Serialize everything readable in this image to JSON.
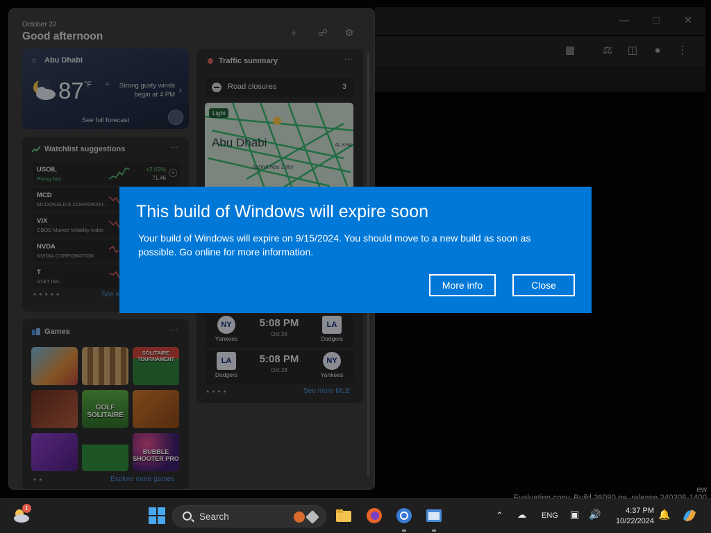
{
  "browser": {
    "toolbar_icons": [
      "extensions-icon",
      "labs-icon",
      "sidebar-icon",
      "profile-icon",
      "menu-icon"
    ],
    "evaluation_text": "Evaluation copy. Build 26080.ge_release.240308-1400",
    "edge_letters": [
      "ew"
    ]
  },
  "widgets": {
    "date": "October 22",
    "greeting": "Good afternoon",
    "weather": {
      "location": "Abu Dhabi",
      "temperature": "87",
      "unit": "°F",
      "alert": "Strong gusty winds begin at 4 PM",
      "forecast_link": "See full forecast"
    },
    "watchlist": {
      "title": "Watchlist suggestions",
      "stocks": [
        {
          "symbol": "USOIL",
          "name": "Rising fast",
          "change": "+2.03%",
          "price": "71.46"
        },
        {
          "symbol": "MCD",
          "name": "MCDONALD'S CORPORATI...",
          "change": "",
          "price": ""
        },
        {
          "symbol": "VIX",
          "name": "CBOE Market Volatility Index",
          "change": "",
          "price": ""
        },
        {
          "symbol": "NVDA",
          "name": "NVIDIA CORPORATION",
          "change": "",
          "price": ""
        },
        {
          "symbol": "T",
          "name": "AT&T INC.",
          "change": "",
          "price": ""
        }
      ],
      "see_more": "See wat"
    },
    "games": {
      "title": "Games",
      "tiles": [
        "",
        "",
        "SOLITAIRE TOURNAMENT",
        "",
        "GOLF SOLITAIRE",
        "",
        "",
        "",
        "BUBBLE SHOOTER PRO"
      ],
      "explore": "Explore more games"
    },
    "traffic": {
      "title": "Traffic summary",
      "road_closures_label": "Road closures",
      "road_closures_count": "3",
      "map_badge": "Light",
      "map_city": "Abu Dhabi",
      "map_island": "Jazirat Abu Zaby",
      "map_side": "AL KHA"
    },
    "sports": {
      "matches": [
        {
          "home": "Yankees",
          "home_logo": "NY",
          "time": "5:08 PM",
          "date": "Oct 26",
          "away": "Dodgers",
          "away_logo": "LA"
        },
        {
          "home": "Dodgers",
          "home_logo": "LA",
          "time": "5:08 PM",
          "date": "Oct 28",
          "away": "Yankees",
          "away_logo": "NY"
        }
      ],
      "see_more": "See more MLB"
    }
  },
  "dialog": {
    "title": "This build of Windows will expire soon",
    "message": "Your build of Windows will expire on 9/15/2024. You should move to a new build as soon as possible. Go online for more information.",
    "more_info": "More info",
    "close": "Close"
  },
  "taskbar": {
    "widget_badge": "1",
    "search_placeholder": "Search",
    "language": "ENG",
    "time": "4:37 PM",
    "date": "10/22/2024"
  }
}
